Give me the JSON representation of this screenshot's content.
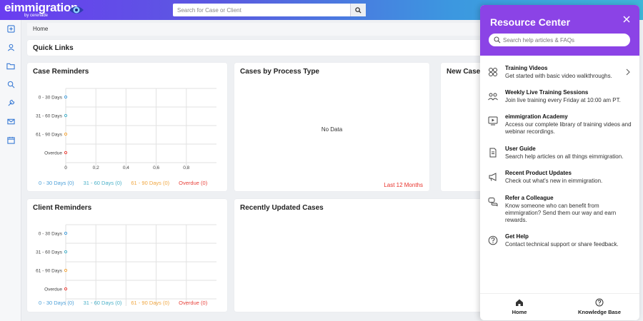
{
  "app": {
    "logo_text": "eimmigration",
    "logo_sub": "by cerenade"
  },
  "search": {
    "placeholder": "Search for Case or Client"
  },
  "breadcrumb": "Home",
  "quick_links": {
    "title": "Quick Links"
  },
  "case_reminders": {
    "title": "Case Reminders",
    "legend": [
      "0 - 30 Days (0)",
      "31 - 60 Days (0)",
      "61 - 90 Days (0)",
      "Overdue (0)"
    ]
  },
  "client_reminders": {
    "title": "Client Reminders",
    "legend": [
      "0 - 30 Days (0)",
      "31 - 60 Days (0)",
      "61 - 90 Days (0)",
      "Overdue (0)"
    ]
  },
  "cases_by_process": {
    "title": "Cases by Process Type",
    "empty": "No Data",
    "range": "Last 12 Months"
  },
  "new_cases": {
    "title": "New Case"
  },
  "recently_updated": {
    "title": "Recently Updated Cases"
  },
  "colors": {
    "bucket_0_30": "#4a9fd8",
    "bucket_31_60": "#4ab0c8",
    "bucket_61_90": "#f0a640",
    "overdue": "#e8423b",
    "panel_purple": "#8b43e6"
  },
  "chart_data": [
    {
      "type": "scatter",
      "title": "Case Reminders",
      "categories": [
        "0 - 30 Days",
        "31 - 60 Days",
        "61 - 90 Days",
        "Overdue"
      ],
      "values": [
        0,
        0,
        0,
        0
      ],
      "xticks": [
        "0",
        "0.2",
        "0.4",
        "0.6",
        "0.8"
      ],
      "xlim": [
        0,
        1
      ],
      "grid": true,
      "legend": "bottom"
    },
    {
      "type": "scatter",
      "title": "Client Reminders",
      "categories": [
        "0 - 30 Days",
        "31 - 60 Days",
        "61 - 90 Days",
        "Overdue"
      ],
      "values": [
        0,
        0,
        0,
        0
      ],
      "xlim": [
        0,
        1
      ],
      "grid": true,
      "legend": "bottom"
    }
  ],
  "resource_center": {
    "title": "Resource Center",
    "search_placeholder": "Search help articles & FAQs",
    "items": [
      {
        "title": "Training Videos",
        "desc": "Get started with basic video walkthroughs.",
        "icon": "film-icon"
      },
      {
        "title": "Weekly Live Training Sessions",
        "desc": "Join live training every Friday at 10:00 am PT.",
        "icon": "people-icon"
      },
      {
        "title": "eimmigration Academy",
        "desc": "Access our complete library of training videos and webinar recordings.",
        "icon": "play-screen-icon"
      },
      {
        "title": "User Guide",
        "desc": "Search help articles on all things eimmigration.",
        "icon": "document-icon"
      },
      {
        "title": "Recent Product Updates",
        "desc": "Check out what's new in eimmigration.",
        "icon": "megaphone-icon"
      },
      {
        "title": "Refer a Colleague",
        "desc": "Know someone who can benefit from eimmigration? Send them our way and earn rewards.",
        "icon": "chat-icon"
      },
      {
        "title": "Get Help",
        "desc": "Contact technical support or share feedback.",
        "icon": "question-icon"
      }
    ],
    "footer": {
      "home": "Home",
      "knowledge_base": "Knowledge Base"
    }
  }
}
